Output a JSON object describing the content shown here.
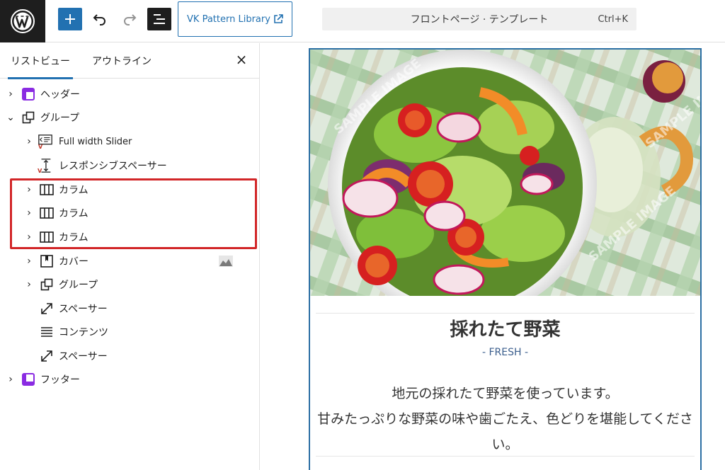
{
  "toolbar": {
    "wp_logo_icon": "wordpress-icon",
    "add_icon": "plus-icon",
    "undo_icon": "undo-icon",
    "redo_icon": "redo-icon",
    "list_view_icon": "list-view-icon",
    "vk_button_label": "VK Pattern Library",
    "external_icon": "external-link-icon",
    "document_title": "フロントページ · テンプレート",
    "shortcut": "Ctrl+K",
    "accent_color": "#2271b1"
  },
  "sidebar": {
    "tabs": [
      {
        "label": "リストビュー",
        "active": true
      },
      {
        "label": "アウトライン",
        "active": false
      }
    ],
    "close_label": "×",
    "tree": [
      {
        "label": "ヘッダー",
        "icon": "template-part-icon",
        "expanded": false
      },
      {
        "label": "グループ",
        "icon": "group-icon",
        "expanded": true
      },
      {
        "label": "Full width Slider",
        "icon": "slider-icon"
      },
      {
        "label": "レスポンシブスペーサー",
        "icon": "spacer-vertical-icon"
      },
      {
        "label": "カラム",
        "icon": "columns-icon"
      },
      {
        "label": "カラム",
        "icon": "columns-icon"
      },
      {
        "label": "カラム",
        "icon": "columns-icon"
      },
      {
        "label": "カバー",
        "icon": "cover-icon"
      },
      {
        "label": "グループ",
        "icon": "group-icon"
      },
      {
        "label": "スペーサー",
        "icon": "spacer-icon"
      },
      {
        "label": "コンテンツ",
        "icon": "content-icon"
      },
      {
        "label": "スペーサー",
        "icon": "spacer-icon"
      },
      {
        "label": "フッター",
        "icon": "template-part-icon"
      }
    ],
    "highlight_color": "#d22628"
  },
  "canvas": {
    "heading": "採れたて野菜",
    "subheading": "- FRESH -",
    "body_lines": [
      "地元の採れたて野菜を使っています。",
      "甘みたっぷりな野菜の味や歯ごたえ、色どりを堪能してくださ",
      "い。"
    ],
    "watermark": "SAMPLE IMAGE"
  }
}
